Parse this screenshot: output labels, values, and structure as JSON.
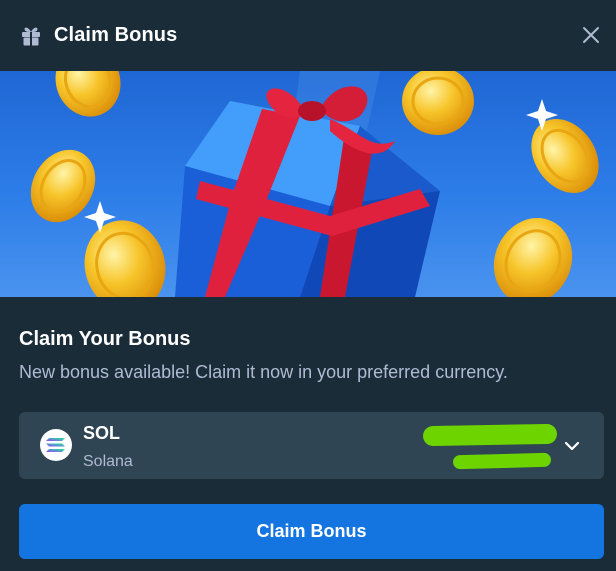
{
  "header": {
    "title": "Claim Bonus",
    "icon": "gift-icon",
    "close_icon": "close-icon"
  },
  "banner": {
    "image": "gift-box-with-gold-coins"
  },
  "content": {
    "heading": "Claim Your Bonus",
    "subtext": "New bonus available! Claim it now in your preferred currency."
  },
  "currency_select": {
    "symbol": "SOL",
    "name": "Solana",
    "icon": "solana-icon",
    "amount_redacted": true,
    "chevron": "chevron-down-icon"
  },
  "claim_button": {
    "label": "Claim Bonus"
  },
  "colors": {
    "background": "#1a2c38",
    "select_bg": "#2f4553",
    "muted_text": "#b1bad3",
    "button": "#1475e1",
    "redaction": "#6ed400"
  }
}
